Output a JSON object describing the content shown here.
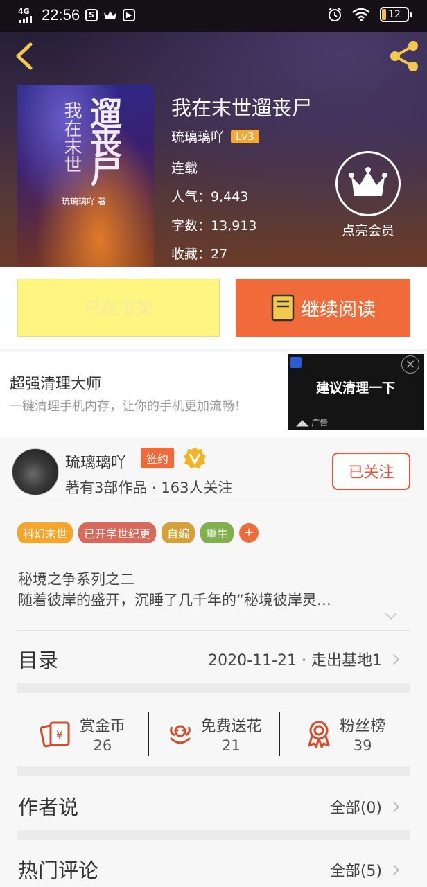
{
  "status_bar": {
    "network": "4G",
    "time": "22:56",
    "battery": "12"
  },
  "book": {
    "title": "我在末世遛丧尸",
    "author": "琉璃璃吖",
    "level": "Lv3",
    "status": "连载",
    "popularity_label": "人气：",
    "popularity": "9,443",
    "words_label": "字数：",
    "words": "13,913",
    "favorites_label": "收藏：",
    "favorites": "27",
    "cover_title_main": "遛丧尸",
    "cover_title_side": "我在末世",
    "cover_author": "琉璃璃吖 著"
  },
  "vip": {
    "label": "点亮会员"
  },
  "actions": {
    "shelf_label": "已在书架",
    "read_label": "继续阅读"
  },
  "ad": {
    "title": "超强清理大师",
    "subtitle": "一键清理手机内存，让你的手机更加流畅！",
    "image_text": "建议清理一下",
    "ad_tag": "广告"
  },
  "author_card": {
    "name": "琉璃璃吖",
    "sign_badge": "签约",
    "stats": "著有3部作品 · 163人关注",
    "follow_label": "已关注"
  },
  "tags": [
    {
      "label": "科幻末世",
      "color": "#f4a52a"
    },
    {
      "label": "已开学世纪更",
      "color": "#d9695a"
    },
    {
      "label": "自编",
      "color": "#d5a03a"
    },
    {
      "label": "重生",
      "color": "#7fb04a"
    }
  ],
  "description": {
    "line1": "秘境之争系列之二",
    "line2": "随着彼岸的盛开，沉睡了几千年的“秘境彼岸灵…"
  },
  "catalog": {
    "title": "目录",
    "latest": "2020-11-21 · 走出基地1"
  },
  "stats": [
    {
      "label": "赏金币",
      "value": "26"
    },
    {
      "label": "免费送花",
      "value": "21"
    },
    {
      "label": "粉丝榜",
      "value": "39"
    }
  ],
  "author_says": {
    "title": "作者说",
    "all": "全部(0)"
  },
  "hot_comments": {
    "title": "热门评论",
    "all": "全部(5)"
  },
  "colors": {
    "accent": "#f06a3a",
    "shelf_yellow": "#fef681",
    "follow_red": "#e8533a"
  }
}
